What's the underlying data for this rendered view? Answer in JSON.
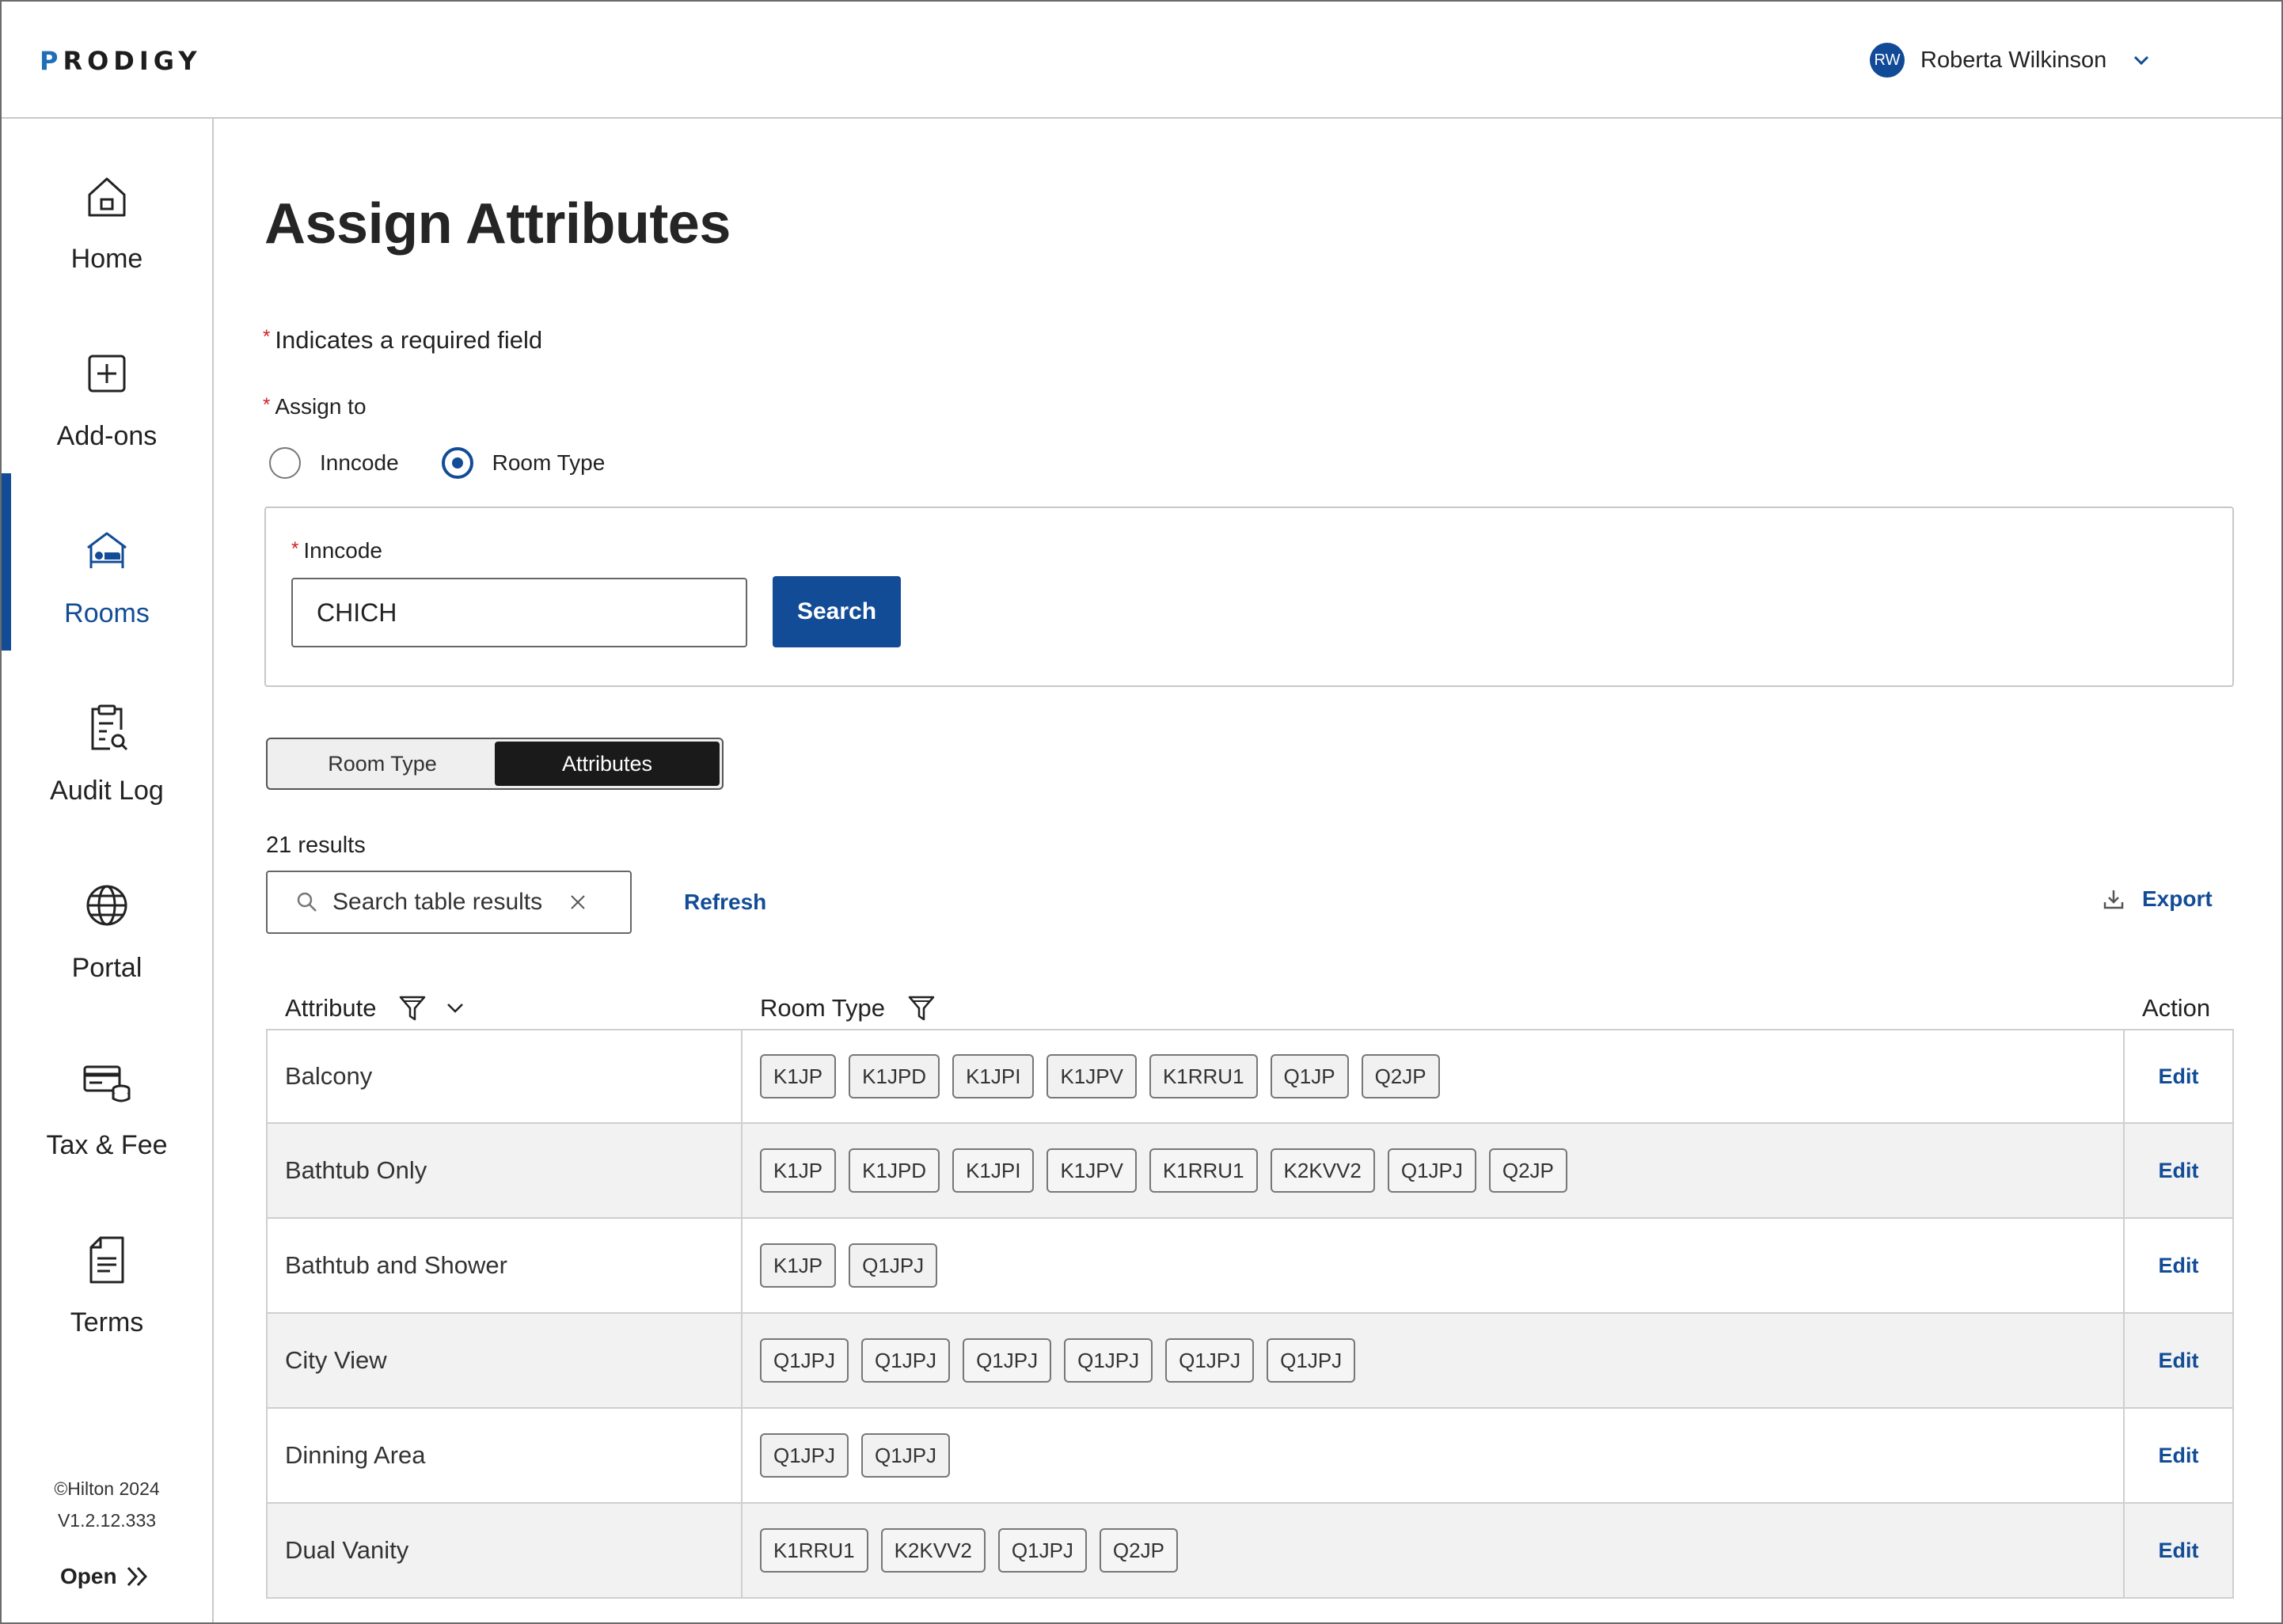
{
  "header": {
    "logo_prefix": "P",
    "logo_rest": "RODIGY",
    "user_initials": "RW",
    "user_name": "Roberta Wilkinson"
  },
  "sidebar": {
    "items": [
      {
        "label": "Home",
        "icon": "home-icon"
      },
      {
        "label": "Add-ons",
        "icon": "plus-square-icon"
      },
      {
        "label": "Rooms",
        "icon": "bed-icon",
        "active": true
      },
      {
        "label": "Audit Log",
        "icon": "clipboard-search-icon"
      },
      {
        "label": "Portal",
        "icon": "globe-icon"
      },
      {
        "label": "Tax & Fee",
        "icon": "card-coins-icon"
      },
      {
        "label": "Terms",
        "icon": "document-icon"
      }
    ],
    "copyright": "©Hilton 2024",
    "version": "V1.2.12.333",
    "open_label": "Open"
  },
  "page": {
    "title": "Assign Attributes",
    "required_note": "Indicates a required field",
    "assign_to_label": "Assign to",
    "radio_options": [
      {
        "label": "Inncode",
        "checked": false
      },
      {
        "label": "Room Type",
        "checked": true
      }
    ],
    "inncode_label": "Inncode",
    "inncode_value": "CHICH",
    "search_button": "Search",
    "segments": [
      {
        "label": "Room Type",
        "active": false
      },
      {
        "label": "Attributes",
        "active": true
      }
    ],
    "results_count": "21 results",
    "table_search_placeholder": "Search table results",
    "refresh_label": "Refresh",
    "export_label": "Export"
  },
  "table": {
    "columns": [
      "Attribute",
      "Room Type",
      "Action"
    ],
    "rows": [
      {
        "attribute": "Balcony",
        "room_types": [
          "K1JP",
          "K1JPD",
          "K1JPI",
          "K1JPV",
          "K1RRU1",
          "Q1JP",
          "Q2JP"
        ],
        "action": "Edit"
      },
      {
        "attribute": "Bathtub Only",
        "room_types": [
          "K1JP",
          "K1JPD",
          "K1JPI",
          "K1JPV",
          "K1RRU1",
          "K2KVV2",
          "Q1JPJ",
          "Q2JP"
        ],
        "action": "Edit"
      },
      {
        "attribute": "Bathtub and Shower",
        "room_types": [
          "K1JP",
          "Q1JPJ"
        ],
        "action": "Edit"
      },
      {
        "attribute": "City View",
        "room_types": [
          "Q1JPJ",
          "Q1JPJ",
          "Q1JPJ",
          "Q1JPJ",
          "Q1JPJ",
          "Q1JPJ"
        ],
        "action": "Edit"
      },
      {
        "attribute": "Dinning Area",
        "room_types": [
          "Q1JPJ",
          "Q1JPJ"
        ],
        "action": "Edit"
      },
      {
        "attribute": "Dual Vanity",
        "room_types": [
          "K1RRU1",
          "K2KVV2",
          "Q1JPJ",
          "Q2JP"
        ],
        "action": "Edit"
      }
    ]
  },
  "colors": {
    "brand_blue": "#124c96",
    "logo_blue": "#1f6fb8",
    "required_red": "#d21f26",
    "row_alt": "#f2f2f2"
  }
}
